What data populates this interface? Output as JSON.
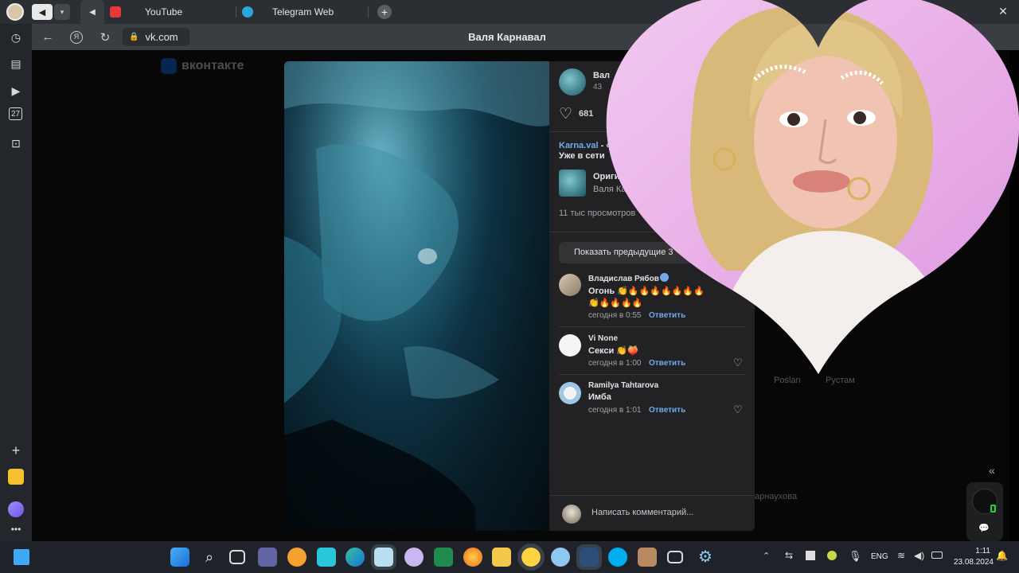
{
  "browser": {
    "tabs": [
      {
        "label": "YouTube"
      },
      {
        "label": "Telegram Web"
      }
    ],
    "address": "vk.com",
    "page_title": "Валя Карнавал"
  },
  "vk": {
    "logo_text": "вконтакте",
    "post": {
      "author_partial": "Вал",
      "followers_partial": "43",
      "likes": "681",
      "caption_author": "Karna.val",
      "caption_rest": " - «",
      "caption_line2": "Уже в сети",
      "sound_title_partial": "Оригин",
      "sound_author_partial": "Валя Ка",
      "views": "11 тыс просмотров",
      "show_previous": "Показать предыдущие 3"
    },
    "comments": [
      {
        "author": "Владислав Рябов",
        "text": "Огонь 👏🔥🔥🔥🔥🔥🔥🔥",
        "text2": "👏🔥🔥🔥🔥",
        "time": "сегодня в 0:55",
        "reply": "Ответить"
      },
      {
        "author": "Vi None",
        "text": "Секси 👏🍑",
        "time": "сегодня в 1:00",
        "reply": "Ответить"
      },
      {
        "author": "Ramilya Tahtarova",
        "text": "Имба",
        "time": "сегодня в 1:01",
        "reply": "Ответить"
      }
    ],
    "comment_placeholder": "Написать комментарий...",
    "bg_friends": [
      "Poslan",
      "Рустам"
    ],
    "bg_partial": "арнаухова"
  },
  "taskbar": {
    "lang": "ENG",
    "time": "1:11",
    "date": "23.08.2024"
  },
  "colors": {
    "accent": "#71aaeb",
    "panel": "#222224",
    "heart": "#e6a8e8"
  }
}
